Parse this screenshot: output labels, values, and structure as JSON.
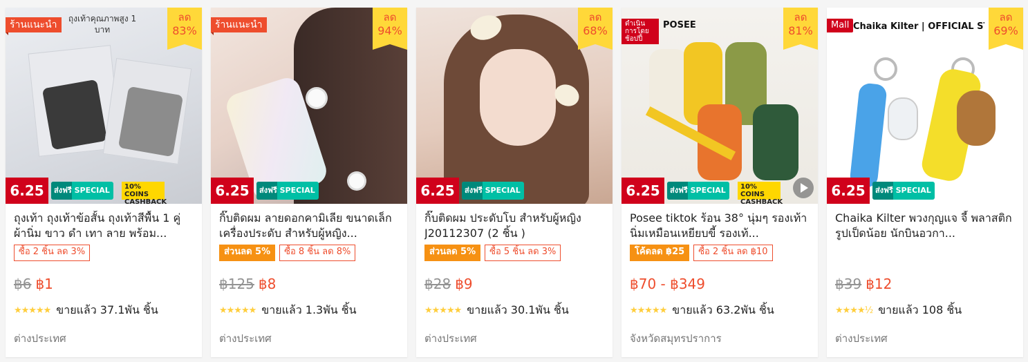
{
  "products": [
    {
      "image_label": "ถุงเท้าคุณภาพสูง 1 บาท",
      "badge": "ร้านแนะนำ",
      "discount_label": "ลด",
      "discount_pct": "83%",
      "promo_date": "6.25",
      "promo_free": "ส่งฟรี SPECIAL",
      "promo_cashback": "10% COINS CASHBACK",
      "name": "ถุงเท้า ถุงเท้าข้อสั้น ถุงเท้าสีพื้น 1 คู่ ผ้านิ่ม ขาว ดำ เทา ลาย พร้อม...",
      "tags": [
        "ซื้อ 2 ชิ้น ลด 3%"
      ],
      "price_old": "฿6",
      "price_now": "฿1",
      "stars": "★★★★★",
      "sold": "ขายแล้ว 37.1พัน ชิ้น",
      "location": "ต่างประเทศ"
    },
    {
      "badge": "ร้านแนะนำ",
      "discount_label": "ลด",
      "discount_pct": "94%",
      "promo_date": "6.25",
      "promo_free": "ส่งฟรี SPECIAL",
      "name": "กิ๊บติดผม ลายดอกคามิเลีย ขนาดเล็ก เครื่องประดับ สําหรับผู้หญิง...",
      "tag_solid": "ส่วนลด 5%",
      "tags": [
        "ซื้อ 8 ชิ้น ลด 8%"
      ],
      "price_old": "฿125",
      "price_now": "฿8",
      "stars": "★★★★★",
      "sold": "ขายแล้ว 1.3พัน ชิ้น",
      "location": "ต่างประเทศ"
    },
    {
      "discount_label": "ลด",
      "discount_pct": "68%",
      "promo_date": "6.25",
      "promo_free": "ส่งฟรี SPECIAL",
      "name": "กิ๊บติดผม ประดับโบ สําหรับผู้หญิง J20112307 (2 ชิ้น )",
      "tag_solid": "ส่วนลด 5%",
      "tags": [
        "ซื้อ 5 ชิ้น ลด 3%"
      ],
      "price_old": "฿28",
      "price_now": "฿9",
      "stars": "★★★★★",
      "sold": "ขายแล้ว 30.1พัน ชิ้น",
      "location": "ต่างประเทศ"
    },
    {
      "badge": "ดำเนินการโดยช้อปปี้",
      "brand": "POSEE",
      "discount_label": "ลด",
      "discount_pct": "81%",
      "promo_date": "6.25",
      "promo_free": "ส่งฟรี SPECIAL",
      "promo_cashback": "10% COINS CASHBACK",
      "name": "Posee tiktok ร้อน 38° นุ่มๆ รองเท้านิ่มเหมือนเหยียบขี้ รองเท้...",
      "tag_solid": "โค้ดลด ฿25",
      "tags": [
        "ซื้อ 2 ชิ้น ลด ฿10"
      ],
      "price_old": "",
      "price_now": "฿70 - ฿349",
      "stars": "★★★★★",
      "sold": "ขายแล้ว 63.2พัน ชิ้น",
      "location": "จังหวัดสมุทรปราการ"
    },
    {
      "badge": "Mall",
      "brand": "Chaika Kilter | OFFICIAL STORE",
      "discount_label": "ลด",
      "discount_pct": "69%",
      "promo_date": "6.25",
      "promo_free": "ส่งฟรี SPECIAL",
      "name": "Chaika Kilter พวงกุญแจ จี้ พลาสติก รูปเป็ดน้อย นักบินอวกา...",
      "tags": [],
      "price_old": "฿39",
      "price_now": "฿12",
      "stars": "★★★★½",
      "sold": "ขายแล้ว 108 ชิ้น",
      "location": "ต่างประเทศ"
    }
  ]
}
